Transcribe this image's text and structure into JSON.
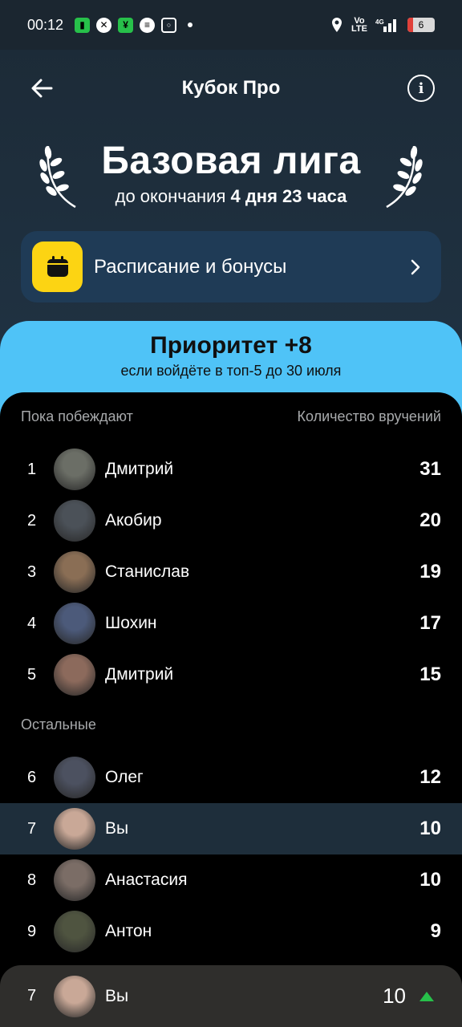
{
  "status": {
    "time": "00:12",
    "battery": "6"
  },
  "header": {
    "title": "Кубок Про"
  },
  "league": {
    "title": "Базовая лига",
    "subtitle_prefix": "до окончания",
    "subtitle_bold": "4 дня 23 часа"
  },
  "schedule": {
    "label": "Расписание и бонусы"
  },
  "priority": {
    "title": "Приоритет +8",
    "subtitle": "если войдёте в топ-5 до 30 июля"
  },
  "leaderboard": {
    "col_left": "Пока побеждают",
    "col_right": "Количество вручений",
    "winners": [
      {
        "rank": "1",
        "name": "Дмитрий",
        "count": "31",
        "avatar_color": "#6b6e66"
      },
      {
        "rank": "2",
        "name": "Акобир",
        "count": "20",
        "avatar_color": "#4b5158"
      },
      {
        "rank": "3",
        "name": "Станислав",
        "count": "19",
        "avatar_color": "#8a6e55"
      },
      {
        "rank": "4",
        "name": "Шохин",
        "count": "17",
        "avatar_color": "#4c5a7a"
      },
      {
        "rank": "5",
        "name": "Дмитрий",
        "count": "15",
        "avatar_color": "#8c6a5c"
      }
    ],
    "others_label": "Остальные",
    "others": [
      {
        "rank": "6",
        "name": "Олег",
        "count": "12",
        "avatar_color": "#4c5160",
        "is_me": false
      },
      {
        "rank": "7",
        "name": "Вы",
        "count": "10",
        "avatar_color": "#c9a897",
        "is_me": true
      },
      {
        "rank": "8",
        "name": "Анастасия",
        "count": "10",
        "avatar_color": "#7b6d66",
        "is_me": false
      },
      {
        "rank": "9",
        "name": "Антон",
        "count": "9",
        "avatar_color": "#4f5440",
        "is_me": false
      }
    ]
  },
  "my_position": {
    "rank": "7",
    "name": "Вы",
    "count": "10"
  },
  "colors": {
    "accent_yellow": "#fcd413",
    "accent_blue": "#4fc3f7",
    "up_green": "#27c04a"
  }
}
